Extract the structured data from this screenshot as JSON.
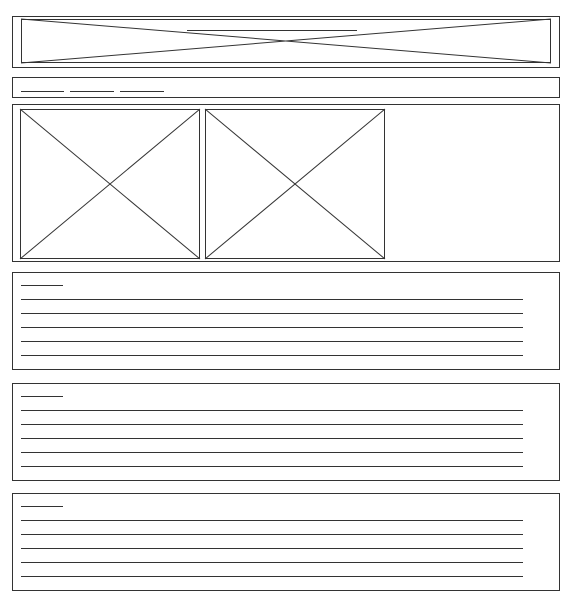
{
  "wireframe": {
    "header": {
      "banner_icon": "image-placeholder-icon",
      "title_bar_present": true
    },
    "nav": {
      "link_count": 3
    },
    "gallery": {
      "image_icons": [
        "image-placeholder-icon",
        "image-placeholder-icon"
      ]
    },
    "text_sections": [
      {
        "heading_placeholder": true,
        "body_line_count": 5
      },
      {
        "heading_placeholder": true,
        "body_line_count": 5
      },
      {
        "heading_placeholder": true,
        "body_line_count": 5
      }
    ],
    "stroke_color": "#333333",
    "background_color": "#ffffff"
  }
}
